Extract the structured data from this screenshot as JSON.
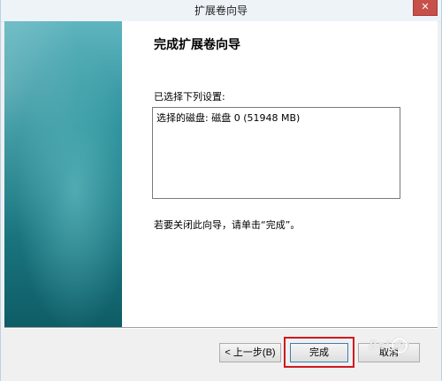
{
  "window": {
    "title": "扩展卷向导",
    "close_glyph": "✕"
  },
  "main": {
    "heading": "完成扩展卷向导",
    "selected_label": "已选择下列设置:",
    "settings": [
      "选择的磁盘: 磁盘 0 (51948 MB)"
    ],
    "hint": "若要关闭此向导，请单击“完成”。"
  },
  "buttons": {
    "back": "< 上一步(B)",
    "finish": "完成",
    "cancel": "取消"
  },
  "watermark": {
    "text": "Bai du"
  },
  "colors": {
    "highlight_frame": "#d0181f",
    "banner_teal": "#1e7d87",
    "close_red": "#c7504a"
  }
}
